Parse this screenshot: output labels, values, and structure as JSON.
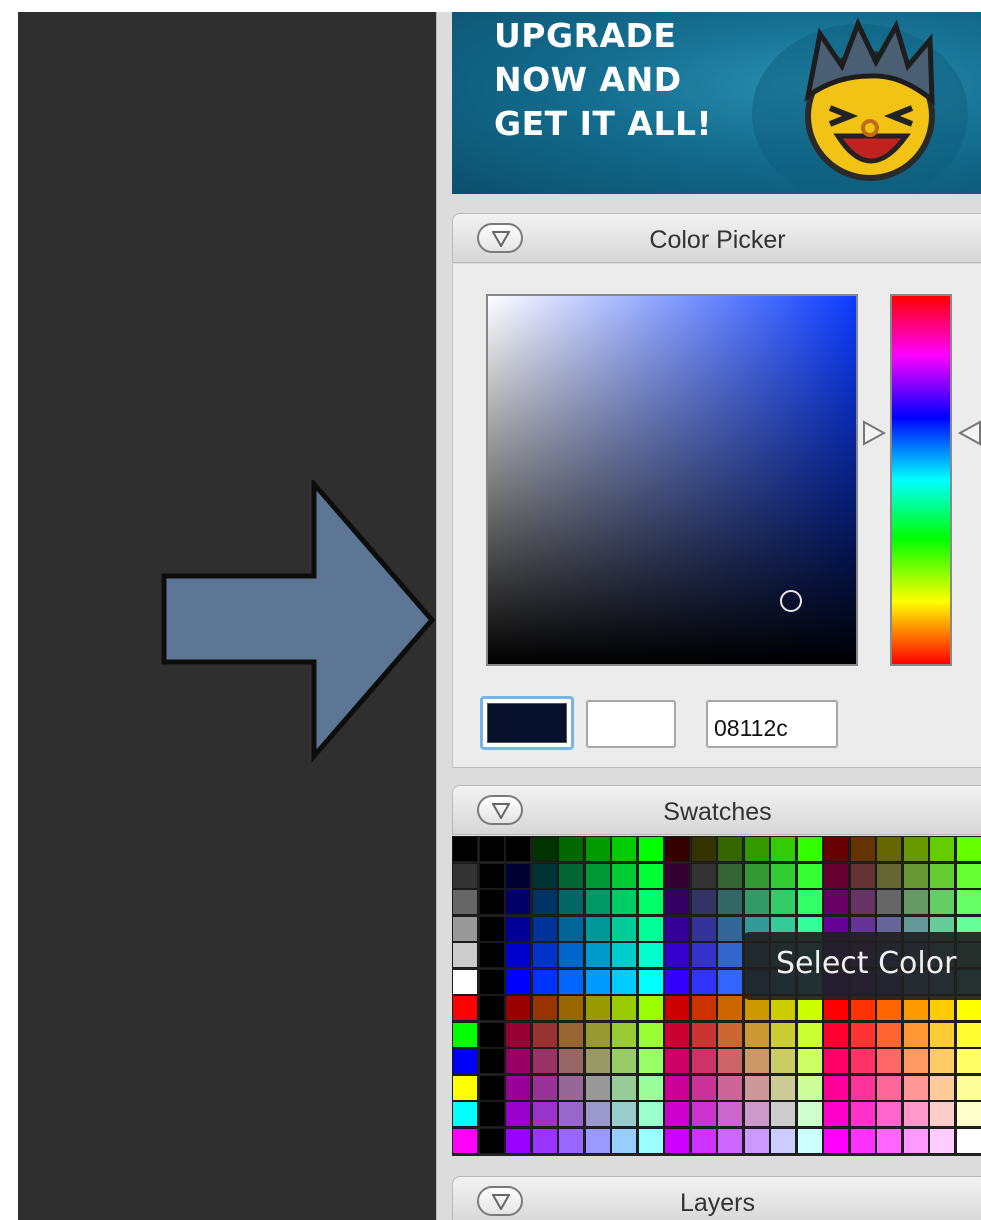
{
  "ad": {
    "lines": [
      "UPGRADE",
      "NOW AND",
      "GET IT ALL!"
    ],
    "mascot_icon": "laughing-boy-mascot"
  },
  "color_picker": {
    "title": "Color Picker",
    "toggle_icon": "collapse-triangle-icon",
    "hex_value": "08112c",
    "current_color": "#08112c",
    "previous_color": "#ffffff"
  },
  "swatches": {
    "title": "Swatches",
    "toggle_icon": "collapse-triangle-icon",
    "tooltip": "Select Color"
  },
  "layers": {
    "title": "Layers",
    "toggle_icon": "collapse-triangle-icon"
  },
  "colors": {
    "left_background": "#2f2f2f",
    "arrow_fill": "#5d7696",
    "selection_border": "#79b4e8"
  }
}
